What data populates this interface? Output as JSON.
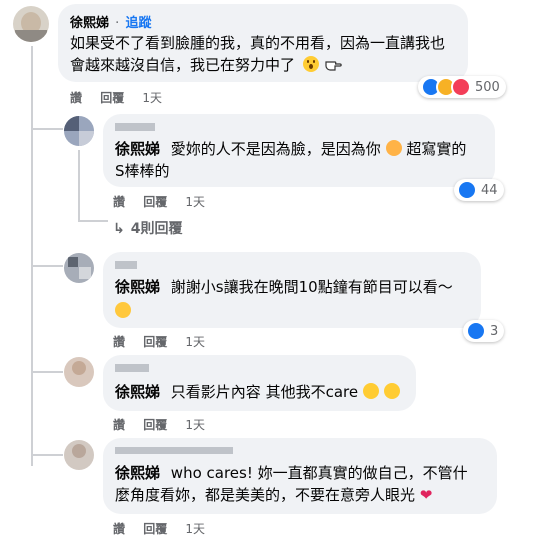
{
  "comments": [
    {
      "author": "徐熙娣",
      "dot": "·",
      "follow": "追蹤",
      "line1": "如果受不了看到臉腫的我，真的不用看，因為一直講我也",
      "line2": "會越來越沒自信，我已在努力中了",
      "reactions_count": "500",
      "actions": {
        "reply": "讚",
        "respond": "回覆",
        "time": "1天"
      }
    },
    {
      "author": "徐熙娣",
      "line1": "愛妳的人不是因為臉，是因為你",
      "line1b": "超寫實的",
      "line2": "S棒棒的",
      "reactions_count": "44",
      "actions": {
        "reply": "讚",
        "respond": "回覆",
        "time": "1天"
      },
      "more_replies": "4則回覆"
    },
    {
      "author": "徐熙娣",
      "line1": "謝謝小s讓我在晚間10點鐘有節目可以看～",
      "reactions_count": "3",
      "actions": {
        "reply": "讚",
        "respond": "回覆",
        "time": "1天"
      }
    },
    {
      "author": "徐熙娣",
      "line1": "只看影片內容 其他我不care",
      "actions": {
        "reply": "讚",
        "respond": "回覆",
        "time": "1天"
      }
    },
    {
      "author": "徐熙娣",
      "line1": "who cares! 妳一直都真實的做自己，不管什",
      "line2": "麼角度看妳，都是美美的，不要在意旁人眼光",
      "actions": {
        "reply": "讚",
        "respond": "回覆",
        "time": "1天"
      }
    }
  ],
  "colors": {
    "bubble": "#f0f2f5",
    "link": "#1877f2",
    "meta": "#65676b",
    "text": "#050505"
  }
}
